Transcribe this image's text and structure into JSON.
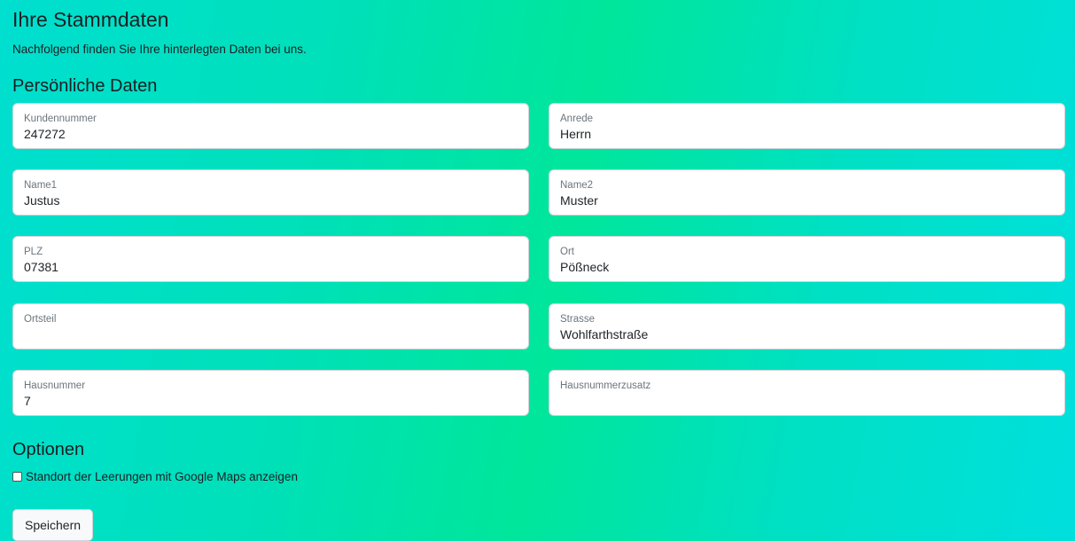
{
  "header": {
    "title": "Ihre Stammdaten",
    "subtitle": "Nachfolgend finden Sie Ihre hinterlegten Daten bei uns."
  },
  "personal": {
    "section_title": "Persönliche Daten",
    "fields": {
      "kundennummer": {
        "label": "Kundennummer",
        "value": "247272"
      },
      "anrede": {
        "label": "Anrede",
        "value": "Herrn"
      },
      "name1": {
        "label": "Name1",
        "value": "Justus"
      },
      "name2": {
        "label": "Name2",
        "value": "Muster"
      },
      "plz": {
        "label": "PLZ",
        "value": "07381"
      },
      "ort": {
        "label": "Ort",
        "value": "Pößneck"
      },
      "ortsteil": {
        "label": "Ortsteil",
        "value": ""
      },
      "strasse": {
        "label": "Strasse",
        "value": "Wohlfarthstraße"
      },
      "hausnummer": {
        "label": "Hausnummer",
        "value": "7"
      },
      "hausnummerzusatz": {
        "label": "Hausnummerzusatz",
        "value": ""
      }
    }
  },
  "options": {
    "section_title": "Optionen",
    "google_maps_checkbox": {
      "label": "Standort der Leerungen mit Google Maps anzeigen",
      "checked": false
    }
  },
  "actions": {
    "save_label": "Speichern"
  }
}
